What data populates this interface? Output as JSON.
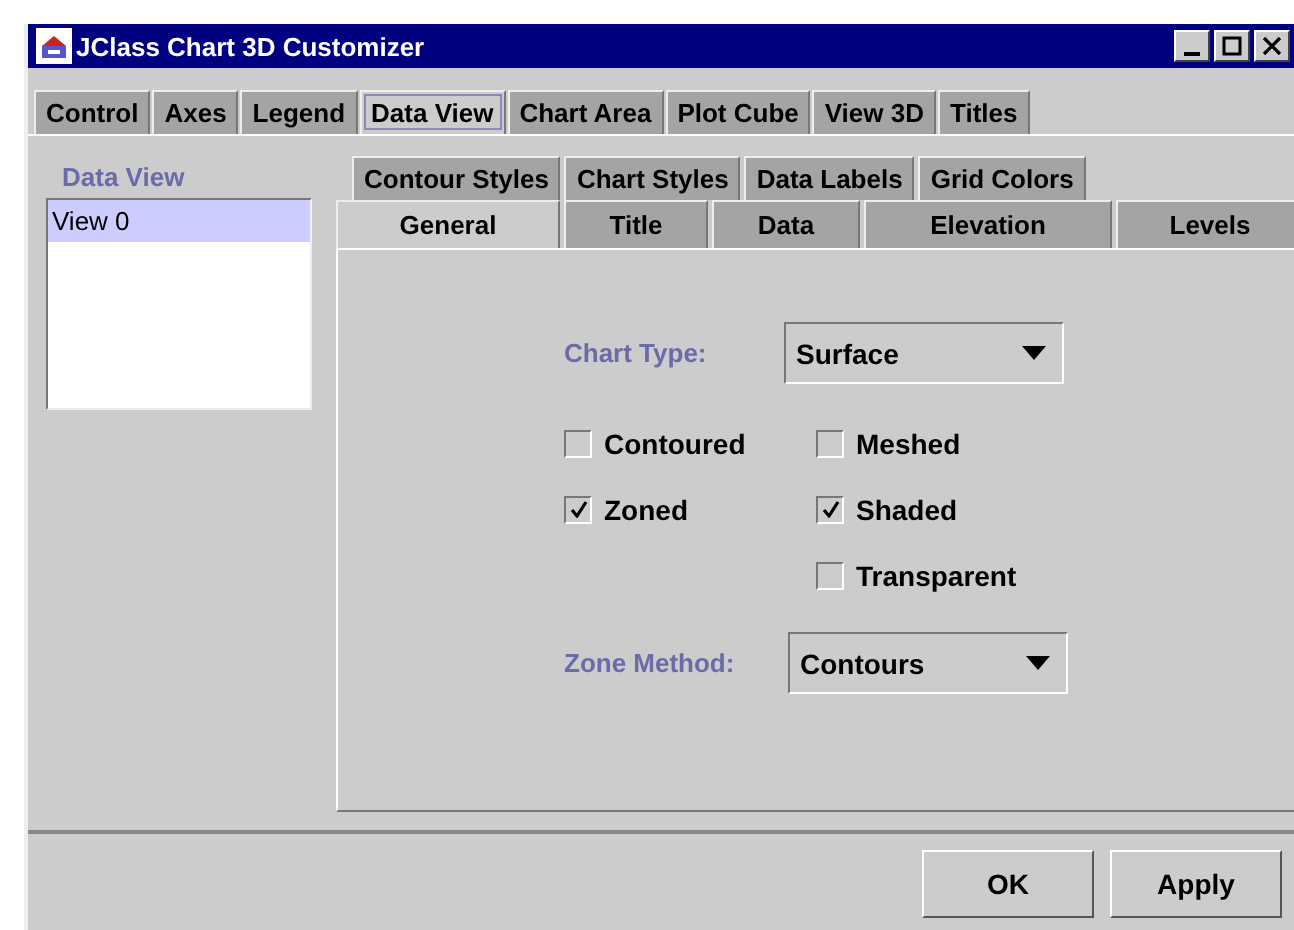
{
  "window": {
    "title": "JClass Chart 3D Customizer"
  },
  "tabs": [
    {
      "label": "Control",
      "selected": false
    },
    {
      "label": "Axes",
      "selected": false
    },
    {
      "label": "Legend",
      "selected": false
    },
    {
      "label": "Data View",
      "selected": true
    },
    {
      "label": "Chart Area",
      "selected": false
    },
    {
      "label": "Plot Cube",
      "selected": false
    },
    {
      "label": "View 3D",
      "selected": false
    },
    {
      "label": "Titles",
      "selected": false
    }
  ],
  "data_view": {
    "label": "Data View",
    "items": [
      {
        "label": "View 0",
        "selected": true
      }
    ]
  },
  "subtab_rows": [
    [
      {
        "label": "Contour Styles",
        "selected": false
      },
      {
        "label": "Chart Styles",
        "selected": false
      },
      {
        "label": "Data Labels",
        "selected": false
      },
      {
        "label": "Grid Colors",
        "selected": false
      }
    ],
    [
      {
        "label": "General",
        "selected": true
      },
      {
        "label": "Title",
        "selected": false
      },
      {
        "label": "Data",
        "selected": false
      },
      {
        "label": "Elevation",
        "selected": false
      },
      {
        "label": "Levels",
        "selected": false
      }
    ]
  ],
  "chart_type": {
    "label": "Chart Type:",
    "value": "Surface"
  },
  "checkbox_columns": [
    [
      {
        "label": "Contoured",
        "checked": false
      },
      {
        "label": "Zoned",
        "checked": true
      }
    ],
    [
      {
        "label": "Meshed",
        "checked": false
      },
      {
        "label": "Shaded",
        "checked": true
      },
      {
        "label": "Transparent",
        "checked": false
      }
    ]
  ],
  "zone_method": {
    "label": "Zone Method:",
    "value": "Contours"
  },
  "buttons": [
    "OK",
    "Apply"
  ]
}
